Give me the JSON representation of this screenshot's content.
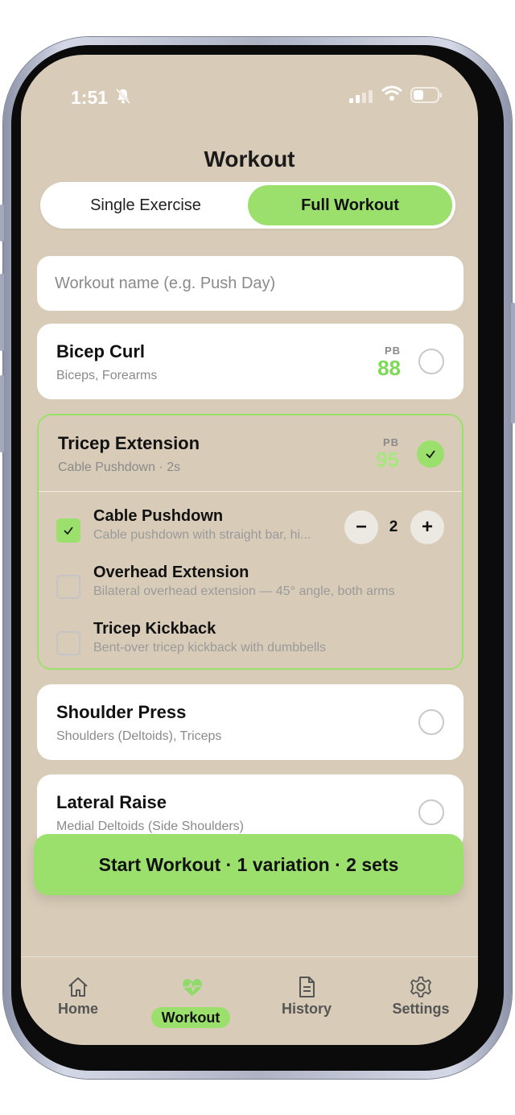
{
  "status_bar": {
    "time": "1:51"
  },
  "header": {
    "title": "Workout"
  },
  "mode_toggle": {
    "single": "Single Exercise",
    "full": "Full Workout",
    "selected": "Full Workout"
  },
  "workout_name": {
    "placeholder": "Workout name (e.g. Push Day)",
    "value": ""
  },
  "exercises": [
    {
      "name": "Bicep Curl",
      "subtitle": "Biceps, Forearms",
      "pb_label": "PB",
      "pb_value": "88",
      "selected": false
    },
    {
      "name": "Tricep Extension",
      "subtitle": "Cable Pushdown · 2s",
      "pb_label": "PB",
      "pb_value": "95",
      "selected": true,
      "variations": [
        {
          "name": "Cable Pushdown",
          "desc": "Cable pushdown with straight bar, hi...",
          "checked": true,
          "sets": "2"
        },
        {
          "name": "Overhead Extension",
          "desc": "Bilateral overhead extension — 45° angle, both arms",
          "checked": false
        },
        {
          "name": "Tricep Kickback",
          "desc": "Bent-over tricep kickback with dumbbells",
          "checked": false
        }
      ]
    },
    {
      "name": "Shoulder Press",
      "subtitle": "Shoulders (Deltoids), Triceps",
      "selected": false
    },
    {
      "name": "Lateral Raise",
      "subtitle": "Medial Deltoids (Side Shoulders)",
      "selected": false
    }
  ],
  "stepper": {
    "minus": "−",
    "plus": "+"
  },
  "start_button": {
    "label": "Start Workout · 1 variation · 2 sets"
  },
  "tabs": [
    {
      "label": "Home",
      "icon": "home-icon"
    },
    {
      "label": "Workout",
      "icon": "heart-pulse-icon",
      "active": true
    },
    {
      "label": "History",
      "icon": "document-icon"
    },
    {
      "label": "Settings",
      "icon": "gear-icon"
    }
  ],
  "colors": {
    "accent": "#9be06c",
    "background": "#d8ccb8",
    "pb": "#7ed957"
  }
}
